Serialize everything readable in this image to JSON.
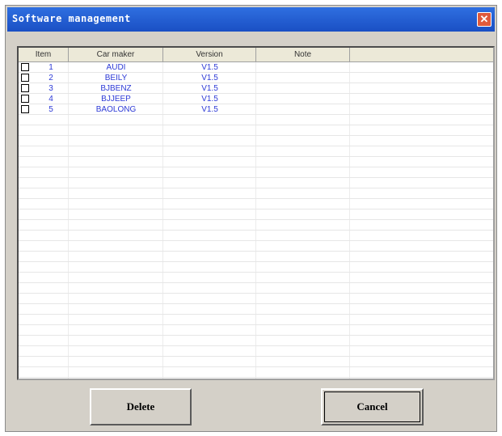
{
  "window": {
    "title": "Software management",
    "close_glyph": "✕"
  },
  "table": {
    "columns": [
      "Item",
      "Car maker",
      "Version",
      "Note"
    ],
    "rows": [
      {
        "item": "1",
        "maker": "AUDI",
        "version": "V1.5",
        "note": ""
      },
      {
        "item": "2",
        "maker": "BEILY",
        "version": "V1.5",
        "note": ""
      },
      {
        "item": "3",
        "maker": "BJBENZ",
        "version": "V1.5",
        "note": ""
      },
      {
        "item": "4",
        "maker": "BJJEEP",
        "version": "V1.5",
        "note": ""
      },
      {
        "item": "5",
        "maker": "BAOLONG",
        "version": "V1.5",
        "note": ""
      }
    ]
  },
  "buttons": {
    "delete": "Delete",
    "cancel": "Cancel"
  }
}
